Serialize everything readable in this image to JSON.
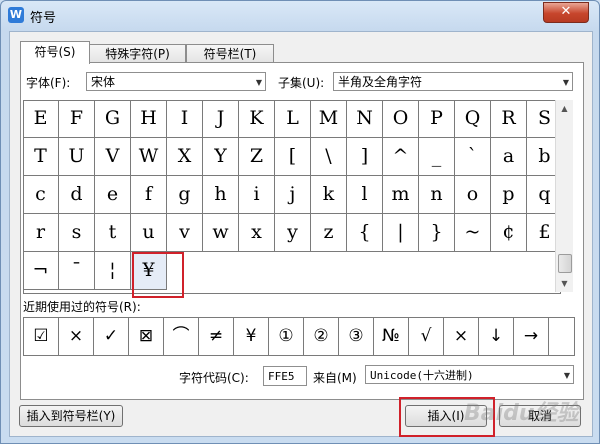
{
  "window": {
    "title": "符号",
    "close_glyph": "✕"
  },
  "tabs": [
    {
      "label": "符号(S)",
      "active": true
    },
    {
      "label": "特殊字符(P)",
      "active": false
    },
    {
      "label": "符号栏(T)",
      "active": false
    }
  ],
  "font": {
    "label": "字体(F):",
    "value": "宋体"
  },
  "subset": {
    "label": "子集(U):",
    "value": "半角及全角字符"
  },
  "grid_rows": [
    [
      "E",
      "F",
      "G",
      "H",
      "I",
      "J",
      "K",
      "L",
      "M",
      "N",
      "O",
      "P",
      "Q",
      "R",
      "S"
    ],
    [
      "T",
      "U",
      "V",
      "W",
      "X",
      "Y",
      "Z",
      "[",
      "\\",
      "]",
      "^",
      "_",
      "`",
      "a",
      "b"
    ],
    [
      "c",
      "d",
      "e",
      "f",
      "g",
      "h",
      "i",
      "j",
      "k",
      "l",
      "m",
      "n",
      "o",
      "p",
      "q"
    ],
    [
      "r",
      "s",
      "t",
      "u",
      "v",
      "w",
      "x",
      "y",
      "z",
      "{",
      "|",
      "}",
      "~",
      "¢",
      "£"
    ],
    [
      "¬",
      "¯",
      "¦",
      "¥"
    ]
  ],
  "selected_symbol": "¥",
  "recent": {
    "label": "近期使用过的符号(R):",
    "symbols": [
      "☑",
      "×",
      "✓",
      "⊠",
      "⌒",
      "≠",
      "¥",
      "①",
      "②",
      "③",
      "№",
      "√",
      "×",
      "↓",
      "→"
    ]
  },
  "char_code": {
    "label": "字符代码(C):",
    "value": "FFE5"
  },
  "from": {
    "label": "来自(M)",
    "value": "Unicode(十六进制)"
  },
  "buttons": {
    "insert_to_bar": "插入到符号栏(Y)",
    "insert": "插入(I)",
    "cancel": "取消"
  },
  "watermark": "Baidu经验"
}
